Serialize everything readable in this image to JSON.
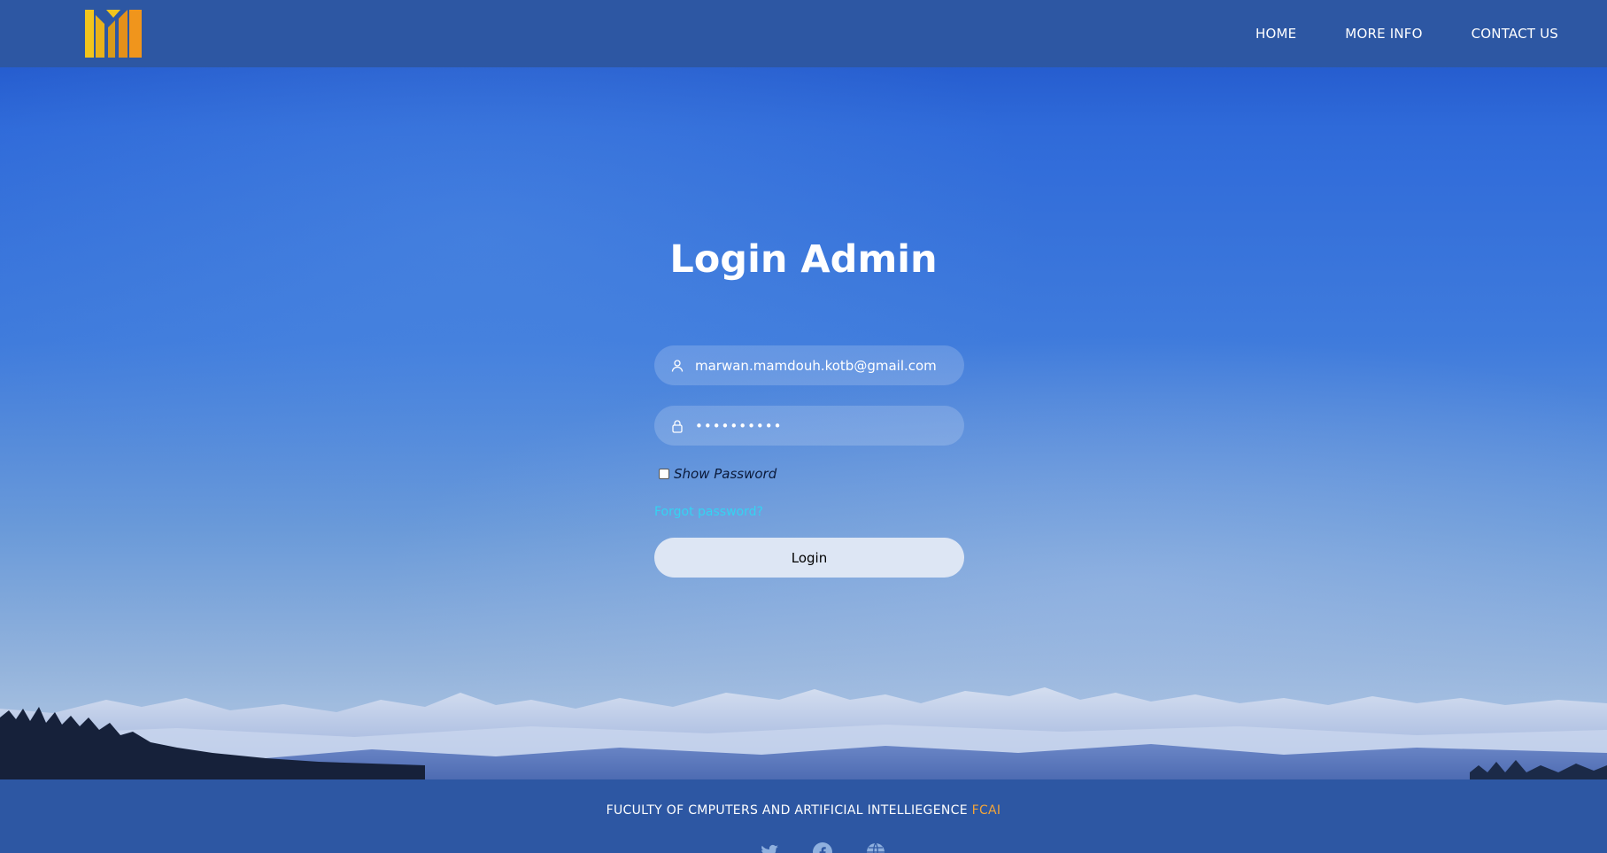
{
  "header": {
    "nav": [
      {
        "label": "HOME"
      },
      {
        "label": "MORE INFO"
      },
      {
        "label": "CONTACT US"
      }
    ]
  },
  "login": {
    "title": "Login Admin",
    "email_value": "marwan.mamdouh.kotb@gmail.com",
    "password_value": "••••••••••",
    "show_password_label": "Show Password",
    "forgot_label": "Forgot password?",
    "login_label": "Login"
  },
  "footer": {
    "text": "FUCULTY OF CMPUTERS AND ARTIFICIAL INTELLIEGENCE",
    "accent": "FCAI",
    "social_icons": [
      "twitter-icon",
      "facebook-icon",
      "globe-icon"
    ]
  },
  "colors": {
    "header_bg": "#2d57a3",
    "accent_orange": "#f1a43a",
    "link_cyan": "#34d3f2",
    "button_bg": "#dde6f4"
  }
}
